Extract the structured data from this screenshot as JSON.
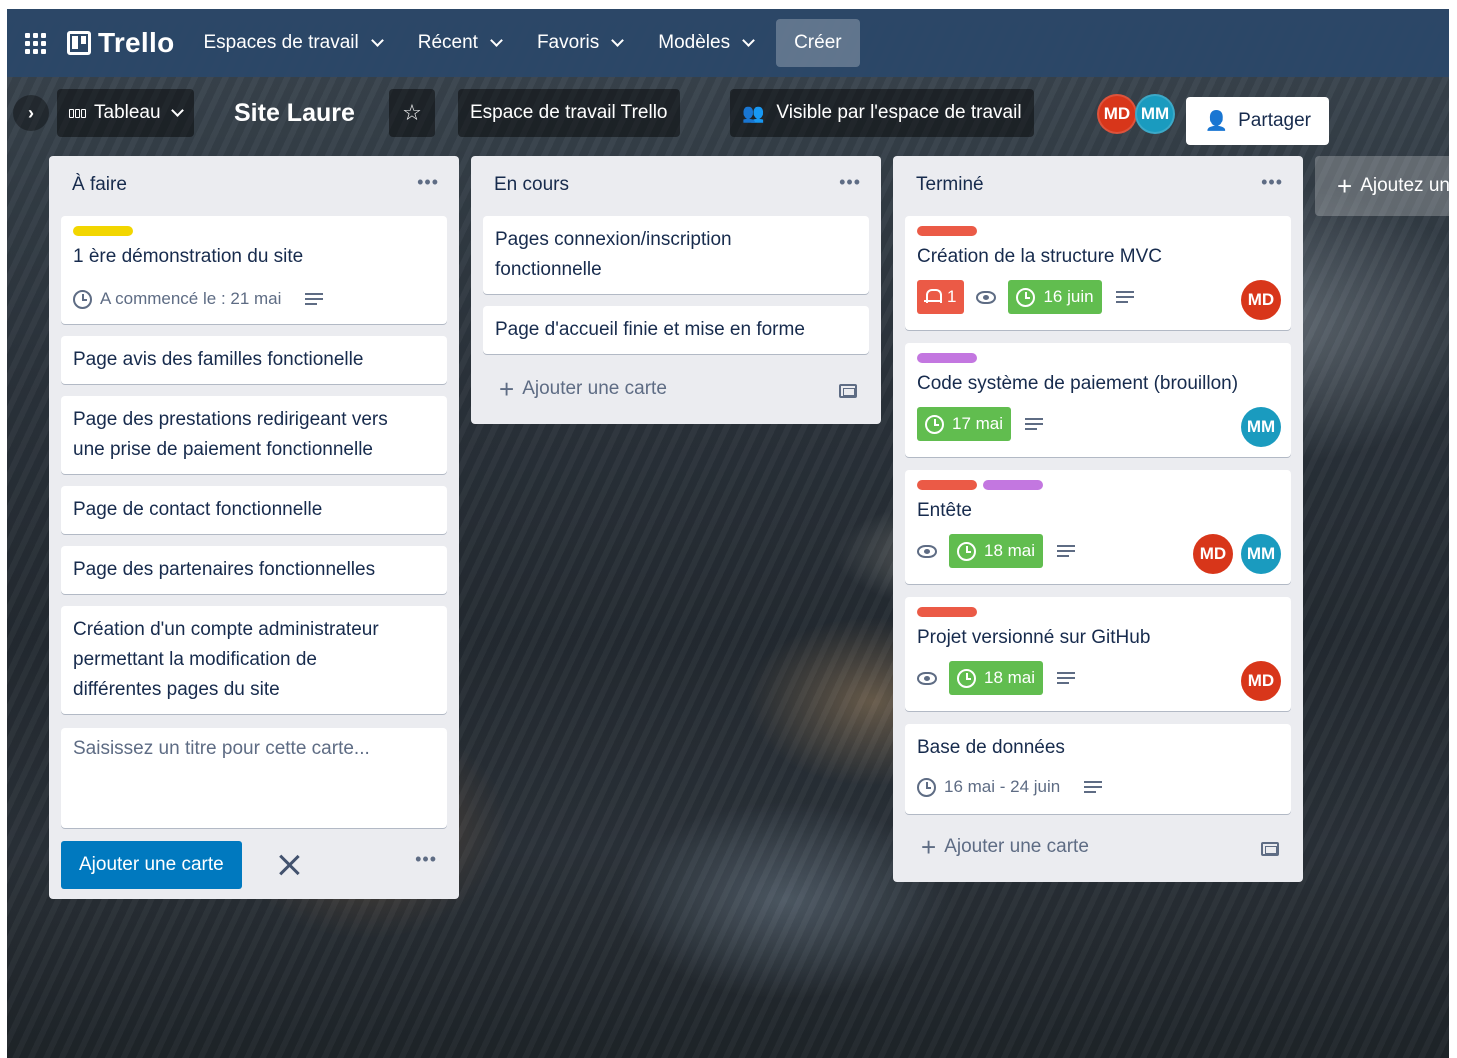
{
  "header": {
    "logo_text": "Trello",
    "nav": [
      {
        "label": "Espaces de travail"
      },
      {
        "label": "Récent"
      },
      {
        "label": "Favoris"
      },
      {
        "label": "Modèles"
      }
    ],
    "create_label": "Créer",
    "accent_color": "#2b4768"
  },
  "board": {
    "view_label": "Tableau",
    "title": "Site Laure",
    "workspace_label": "Espace de travail Trello",
    "visibility_label": "Visible par l'espace de travail",
    "members": [
      "MD",
      "MM"
    ],
    "share_label": "Partager",
    "add_list_label": "Ajoutez une autre liste"
  },
  "lists": [
    {
      "title": "À faire",
      "cards": [
        {
          "title": "1 ère démonstration du site",
          "labels": [
            "#f2d600"
          ],
          "start_text": "A commencé le : 21 mai"
        },
        {
          "title": "Page avis des familles fonctionelle"
        },
        {
          "title_lines": [
            "Page des prestations redirigeant vers",
            "une prise de paiement fonctionnelle"
          ]
        },
        {
          "title": "Page de contact fonctionnelle"
        },
        {
          "title": "Page des partenaires fonctionnelles"
        },
        {
          "title_lines": [
            "Création d'un compte administrateur",
            "permettant la modification de",
            "différentes pages du site"
          ]
        }
      ],
      "composer_placeholder": "Saisissez un titre pour cette carte...",
      "add_button_label": "Ajouter une carte"
    },
    {
      "title": "En cours",
      "cards": [
        {
          "title_lines": [
            "Pages connexion/inscription",
            "fonctionnelle"
          ]
        },
        {
          "title": "Page d'accueil finie et mise en forme"
        }
      ],
      "add_card_label": "Ajouter une carte"
    },
    {
      "title": "Terminé",
      "cards": [
        {
          "title": "Création de la structure MVC",
          "labels": [
            "#eb5a46"
          ],
          "notifications": "1",
          "due": "16 juin",
          "members": [
            "MD"
          ]
        },
        {
          "title": "Code système de paiement (brouillon)",
          "labels": [
            "#c377e0"
          ],
          "due": "17 mai",
          "members": [
            "MM"
          ]
        },
        {
          "title": "Entête",
          "labels": [
            "#eb5a46",
            "#c377e0"
          ],
          "due": "18 mai",
          "members": [
            "MD",
            "MM"
          ]
        },
        {
          "title": "Projet versionné sur GitHub",
          "labels": [
            "#eb5a46"
          ],
          "due": "18 mai",
          "members": [
            "MD"
          ]
        },
        {
          "title": "Base de données",
          "dates": "16 mai - 24 juin"
        }
      ],
      "add_card_label": "Ajouter une carte"
    }
  ],
  "colors": {
    "due_complete": "#61bd4f",
    "notification": "#eb5a46",
    "member_md": "#d8361a",
    "member_mm": "#1a9bbf",
    "primary_button": "#0079bf"
  }
}
